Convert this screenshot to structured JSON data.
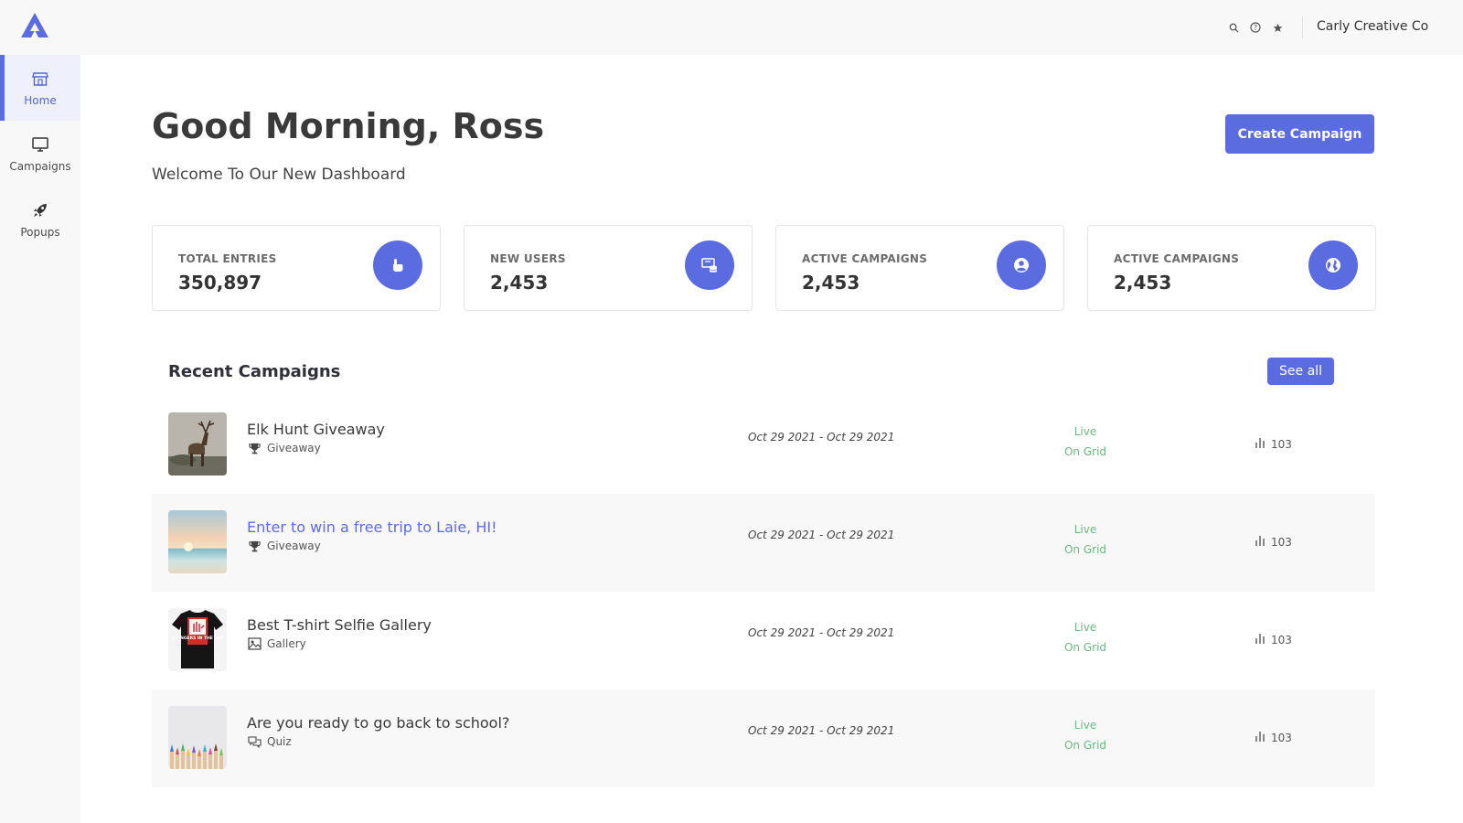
{
  "header": {
    "company": "Carly Creative Co",
    "icons": [
      "search-icon",
      "help-icon",
      "star-icon"
    ]
  },
  "sidebar": {
    "items": [
      {
        "label": "Home",
        "icon": "storefront-icon",
        "active": true
      },
      {
        "label": "Campaigns",
        "icon": "monitor-icon",
        "active": false
      },
      {
        "label": "Popups",
        "icon": "rocket-icon",
        "active": false
      }
    ]
  },
  "greeting": {
    "title": "Good Morning, Ross",
    "subtitle": "Welcome To Our New Dashboard"
  },
  "actions": {
    "create_campaign": "Create Campaign",
    "see_all": "See all"
  },
  "stats": [
    {
      "label": "TOTAL ENTRIES",
      "value": "350,897",
      "icon": "hand-pointer-icon"
    },
    {
      "label": "NEW USERS",
      "value": "2,453",
      "icon": "database-icon"
    },
    {
      "label": "ACTIVE CAMPAIGNS",
      "value": "2,453",
      "icon": "user-circle-icon"
    },
    {
      "label": "ACTIVE CAMPAIGNS",
      "value": "2,453",
      "icon": "globe-icon"
    }
  ],
  "recent": {
    "title": "Recent Campaigns",
    "rows": [
      {
        "name": "Elk Hunt Giveaway",
        "type": "Giveaway",
        "type_icon": "trophy-icon",
        "dates": "Oct 29 2021 - Oct 29 2021",
        "status1": "Live",
        "status2": "On Grid",
        "count": "103"
      },
      {
        "name": "Enter to win a free trip to Laie, HI!",
        "type": "Giveaway",
        "type_icon": "trophy-icon",
        "dates": "Oct 29 2021 - Oct 29 2021",
        "status1": "Live",
        "status2": "On Grid",
        "count": "103"
      },
      {
        "name": "Best T-shirt Selfie Gallery",
        "type": "Gallery",
        "type_icon": "image-icon",
        "dates": "Oct 29 2021 - Oct 29 2021",
        "status1": "Live",
        "status2": "On Grid",
        "count": "103"
      },
      {
        "name": "Are you ready to go back to school?",
        "type": "Quiz",
        "type_icon": "chat-bubbles-icon",
        "dates": "Oct 29 2021 - Oct 29 2021",
        "status1": "Live",
        "status2": "On Grid",
        "count": "103"
      }
    ],
    "tshirt_text": "3 FINGERS IN THE SKY"
  },
  "colors": {
    "accent": "#5b6ce0",
    "live": "#6cb77f",
    "sidebar_bg": "#f8f8f8"
  }
}
